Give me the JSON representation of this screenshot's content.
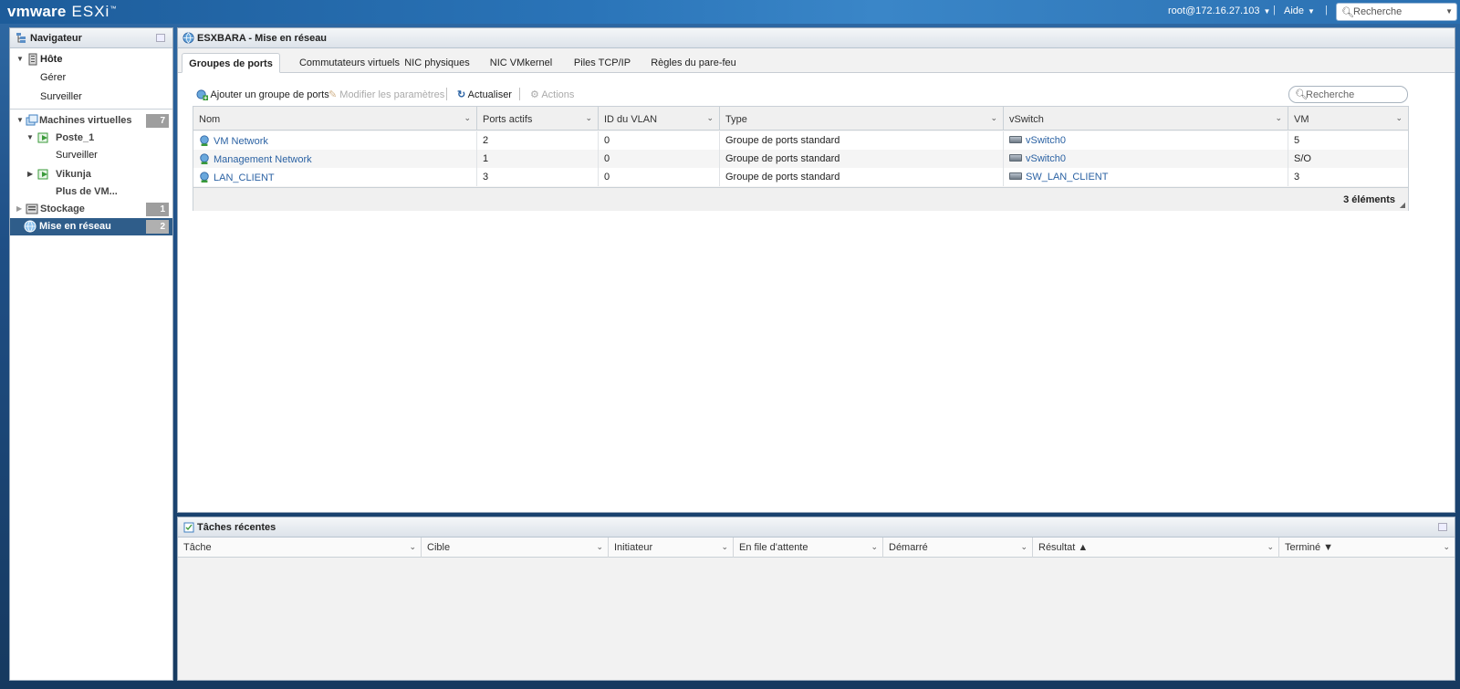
{
  "topbar": {
    "brand": "vmware",
    "product": "ESXi",
    "tm": "™",
    "user": "root@172.16.27.103",
    "help": "Aide",
    "search_placeholder": "Recherche"
  },
  "navigator": {
    "title": "Navigateur",
    "items": [
      {
        "label": "Hôte"
      },
      {
        "label": "Gérer"
      },
      {
        "label": "Surveiller"
      },
      {
        "label": "Machines virtuelles",
        "badge": "7"
      },
      {
        "label": "Poste_1"
      },
      {
        "label": "Surveiller"
      },
      {
        "label": "Vikunja"
      },
      {
        "label": "Plus de VM..."
      },
      {
        "label": "Stockage",
        "badge": "1"
      },
      {
        "label": "Mise en réseau",
        "badge": "2"
      }
    ]
  },
  "main": {
    "title": "ESXBARA - Mise en réseau",
    "tabs": [
      "Groupes de ports",
      "Commutateurs virtuels",
      "NIC physiques",
      "NIC VMkernel",
      "Piles TCP/IP",
      "Règles du pare-feu"
    ],
    "toolbar": {
      "add": "Ajouter un groupe de ports",
      "edit": "Modifier les paramètres",
      "refresh": "Actualiser",
      "actions": "Actions",
      "search_placeholder": "Recherche"
    },
    "grid": {
      "columns": [
        "Nom",
        "Ports actifs",
        "ID du VLAN",
        "Type",
        "vSwitch",
        "VM"
      ],
      "rows": [
        {
          "name": "VM Network",
          "ports": "2",
          "vlan": "0",
          "type": "Groupe de ports standard",
          "vswitch": "vSwitch0",
          "vm": "5"
        },
        {
          "name": "Management Network",
          "ports": "1",
          "vlan": "0",
          "type": "Groupe de ports standard",
          "vswitch": "vSwitch0",
          "vm": "S/O"
        },
        {
          "name": "LAN_CLIENT",
          "ports": "3",
          "vlan": "0",
          "type": "Groupe de ports standard",
          "vswitch": "SW_LAN_CLIENT",
          "vm": "3"
        }
      ],
      "footer_count": "3 éléments"
    }
  },
  "tasks": {
    "title": "Tâches récentes",
    "columns": [
      "Tâche",
      "Cible",
      "Initiateur",
      "En file d'attente",
      "Démarré",
      "Résultat ▲",
      "Terminé ▼"
    ]
  },
  "colors": {
    "selected_nav": "#2f5d8a",
    "link": "#2b62a3",
    "badge": "#9e9e9e"
  }
}
